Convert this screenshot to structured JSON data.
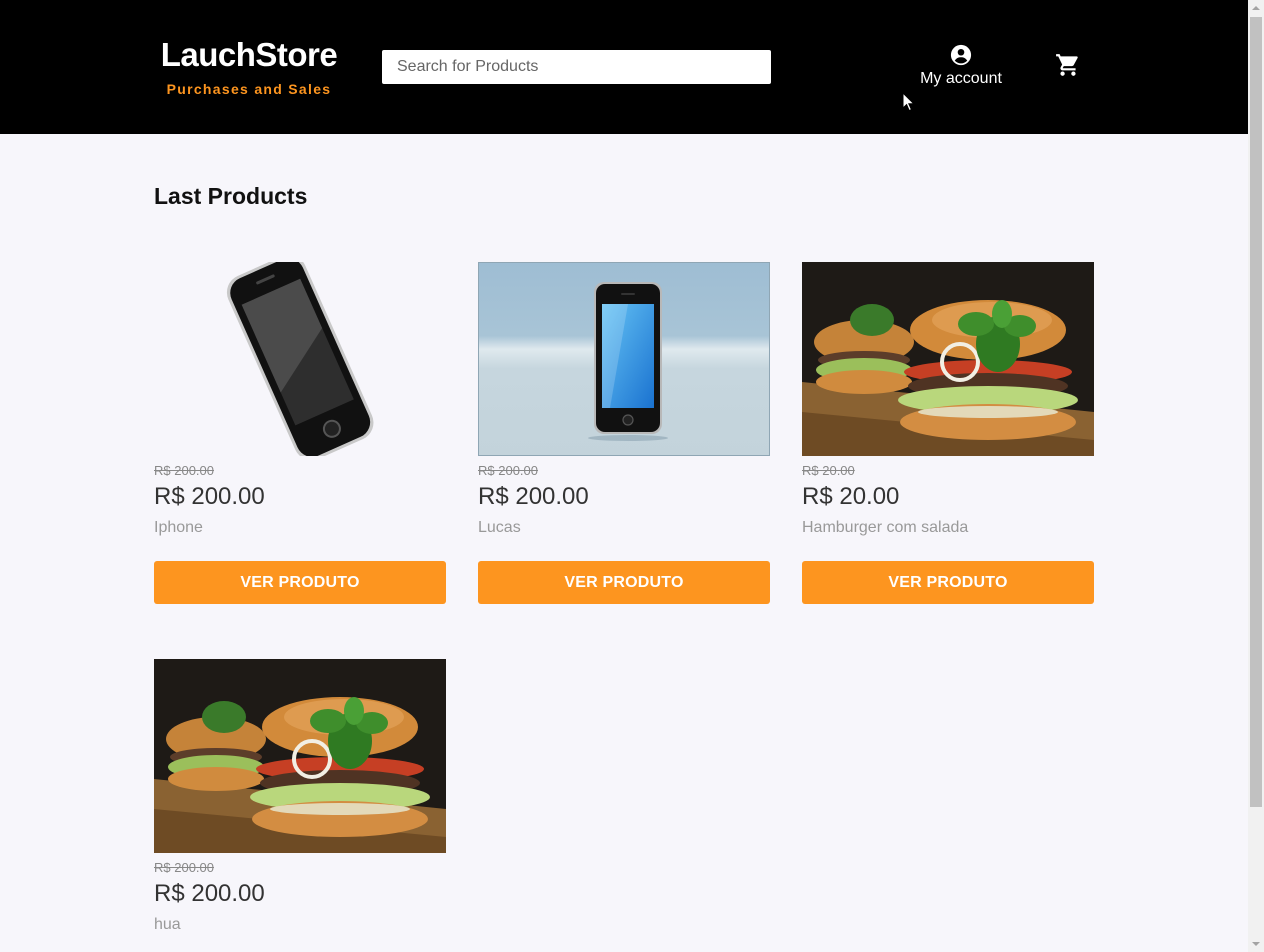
{
  "header": {
    "brand": "LauchStore",
    "tagline": "Purchases and Sales",
    "search_placeholder": "Search for Products",
    "account_label": "My account",
    "account_icon": "account-circle-icon",
    "cart_icon": "shopping-cart-icon"
  },
  "colors": {
    "header_bg": "#000000",
    "accent": "#fd951f",
    "page_bg": "#f7f6fb"
  },
  "main": {
    "section_title": "Last Products",
    "products": [
      {
        "old_price": "R$ 200.00",
        "price": "R$ 200.00",
        "name": "Iphone",
        "button": "VER PRODUTO",
        "image": "black-smartphone-photo"
      },
      {
        "old_price": "R$ 200.00",
        "price": "R$ 200.00",
        "name": "Lucas",
        "button": "VER PRODUTO",
        "image": "blue-screen-smartphone-photo"
      },
      {
        "old_price": "R$ 20.00",
        "price": "R$ 20.00",
        "name": "Hamburger com salada",
        "button": "VER PRODUTO",
        "image": "hamburger-photo"
      },
      {
        "old_price": "R$ 200.00",
        "price": "R$ 200.00",
        "name": "hua",
        "button": "VER PRODUTO",
        "image": "hamburger-photo"
      }
    ]
  }
}
